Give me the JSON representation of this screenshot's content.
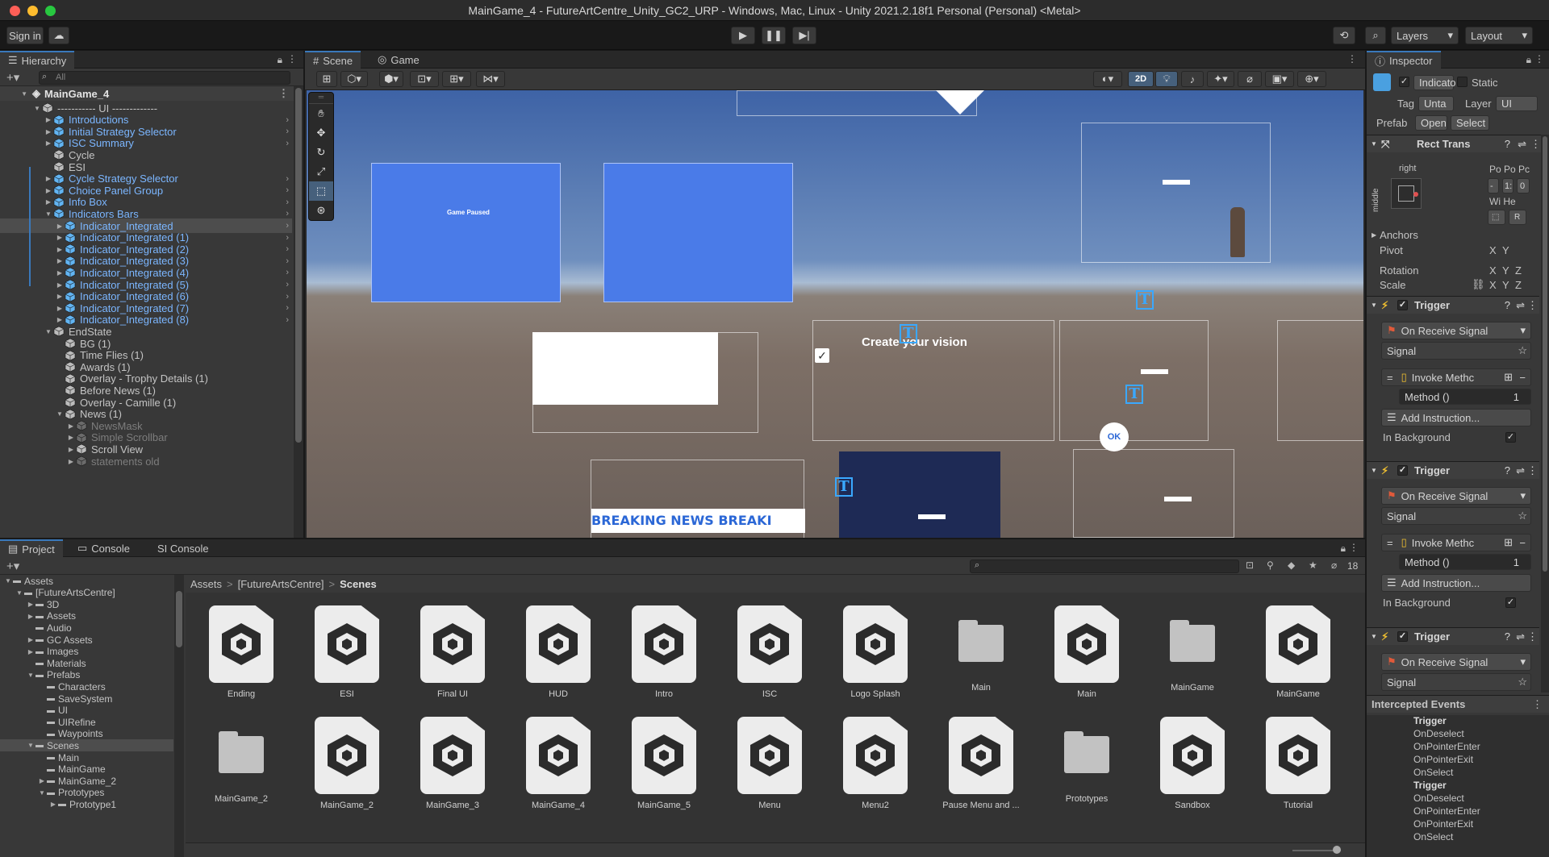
{
  "window": {
    "title": "MainGame_4 - FutureArtCentre_Unity_GC2_URP - Windows, Mac, Linux - Unity 2021.2.18f1 Personal (Personal) <Metal>"
  },
  "toolbar": {
    "sign_in": "Sign in",
    "layers": "Layers",
    "layout": "Layout"
  },
  "hierarchy": {
    "tab": "Hierarchy",
    "search_placeholder": "All",
    "scene_name": "MainGame_4",
    "rows": [
      {
        "label": "----------- UI -------------",
        "indent": 1,
        "style": "normal"
      },
      {
        "label": "Introductions",
        "indent": 2,
        "style": "blue"
      },
      {
        "label": "Initial Strategy Selector",
        "indent": 2,
        "style": "blue"
      },
      {
        "label": "ISC Summary",
        "indent": 2,
        "style": "blue"
      },
      {
        "label": "Cycle",
        "indent": 2,
        "style": "normal"
      },
      {
        "label": "ESI",
        "indent": 2,
        "style": "normal"
      },
      {
        "label": "Cycle Strategy Selector",
        "indent": 2,
        "style": "blue"
      },
      {
        "label": "Choice Panel Group",
        "indent": 2,
        "style": "blue"
      },
      {
        "label": "Info Box",
        "indent": 2,
        "style": "blue"
      },
      {
        "label": "Indicators Bars",
        "indent": 2,
        "style": "blue"
      },
      {
        "label": "Indicator_Integrated",
        "indent": 3,
        "style": "selected"
      },
      {
        "label": "Indicator_Integrated (1)",
        "indent": 3,
        "style": "blue"
      },
      {
        "label": "Indicator_Integrated (2)",
        "indent": 3,
        "style": "blue"
      },
      {
        "label": "Indicator_Integrated (3)",
        "indent": 3,
        "style": "blue"
      },
      {
        "label": "Indicator_Integrated (4)",
        "indent": 3,
        "style": "blue"
      },
      {
        "label": "Indicator_Integrated (5)",
        "indent": 3,
        "style": "blue"
      },
      {
        "label": "Indicator_Integrated (6)",
        "indent": 3,
        "style": "blue"
      },
      {
        "label": "Indicator_Integrated (7)",
        "indent": 3,
        "style": "blue"
      },
      {
        "label": "Indicator_Integrated (8)",
        "indent": 3,
        "style": "blue"
      },
      {
        "label": "EndState",
        "indent": 2,
        "style": "normal"
      },
      {
        "label": "BG (1)",
        "indent": 3,
        "style": "normal"
      },
      {
        "label": "Time Flies (1)",
        "indent": 3,
        "style": "normal"
      },
      {
        "label": "Awards (1)",
        "indent": 3,
        "style": "normal"
      },
      {
        "label": "Overlay - Trophy Details (1)",
        "indent": 3,
        "style": "normal"
      },
      {
        "label": "Before News (1)",
        "indent": 3,
        "style": "normal"
      },
      {
        "label": "Overlay - Camille (1)",
        "indent": 3,
        "style": "normal"
      },
      {
        "label": "News (1)",
        "indent": 3,
        "style": "normal"
      },
      {
        "label": "NewsMask",
        "indent": 4,
        "style": "dim"
      },
      {
        "label": "Simple Scrollbar",
        "indent": 4,
        "style": "dim"
      },
      {
        "label": "Scroll View",
        "indent": 4,
        "style": "normal"
      },
      {
        "label": "statements old",
        "indent": 4,
        "style": "dim"
      }
    ]
  },
  "scene_view": {
    "tab_scene": "Scene",
    "tab_game": "Game",
    "btn_2d": "2D",
    "overlay_text": {
      "game_paused": "Game Paused",
      "create_vision": "Create your vision",
      "breaking_news": "BREAKING NEWS   BREAKI",
      "ok": "OK"
    }
  },
  "project": {
    "tabs": [
      "Project",
      "Console",
      "SI Console"
    ],
    "hidden_count": "18",
    "breadcrumb": [
      "Assets",
      "[FutureArtsCentre]",
      "Scenes"
    ],
    "tree": [
      {
        "label": "Assets",
        "indent": 0
      },
      {
        "label": "[FutureArtsCentre]",
        "indent": 1
      },
      {
        "label": "3D",
        "indent": 2
      },
      {
        "label": "Assets",
        "indent": 2
      },
      {
        "label": "Audio",
        "indent": 2
      },
      {
        "label": "GC Assets",
        "indent": 2
      },
      {
        "label": "Images",
        "indent": 2
      },
      {
        "label": "Materials",
        "indent": 2
      },
      {
        "label": "Prefabs",
        "indent": 2
      },
      {
        "label": "Characters",
        "indent": 3
      },
      {
        "label": "SaveSystem",
        "indent": 3
      },
      {
        "label": "UI",
        "indent": 3
      },
      {
        "label": "UIRefine",
        "indent": 3
      },
      {
        "label": "Waypoints",
        "indent": 3
      },
      {
        "label": "Scenes",
        "indent": 2
      },
      {
        "label": "Main",
        "indent": 3
      },
      {
        "label": "MainGame",
        "indent": 3
      },
      {
        "label": "MainGame_2",
        "indent": 3
      },
      {
        "label": "Prototypes",
        "indent": 3
      },
      {
        "label": "Prototype1",
        "indent": 4
      }
    ],
    "items": [
      {
        "label": "Ending",
        "kind": "scene"
      },
      {
        "label": "ESI",
        "kind": "scene"
      },
      {
        "label": "Final UI",
        "kind": "scene"
      },
      {
        "label": "HUD",
        "kind": "scene"
      },
      {
        "label": "Intro",
        "kind": "scene"
      },
      {
        "label": "ISC",
        "kind": "scene"
      },
      {
        "label": "Logo Splash",
        "kind": "scene"
      },
      {
        "label": "Main",
        "kind": "folder"
      },
      {
        "label": "Main",
        "kind": "scene"
      },
      {
        "label": "MainGame",
        "kind": "folder"
      },
      {
        "label": "MainGame",
        "kind": "scene"
      },
      {
        "label": "MainGame_2",
        "kind": "folder"
      },
      {
        "label": "MainGame_2",
        "kind": "scene"
      },
      {
        "label": "MainGame_3",
        "kind": "scene"
      },
      {
        "label": "MainGame_4",
        "kind": "scene"
      },
      {
        "label": "MainGame_5",
        "kind": "scene"
      },
      {
        "label": "Menu",
        "kind": "scene"
      },
      {
        "label": "Menu2",
        "kind": "scene"
      },
      {
        "label": "Pause Menu and ...",
        "kind": "scene"
      },
      {
        "label": "Prototypes",
        "kind": "folder"
      },
      {
        "label": "Sandbox",
        "kind": "scene"
      },
      {
        "label": "Tutorial",
        "kind": "scene"
      }
    ]
  },
  "inspector": {
    "tab": "Inspector",
    "object_name": "Indicato",
    "static_label": "Static",
    "tag_label": "Tag",
    "tag_value": "Unta",
    "layer_label": "Layer",
    "layer_value": "UI",
    "prefab_label": "Prefab",
    "prefab_open": "Open",
    "prefab_select": "Select",
    "rect_transform": "Rect Trans",
    "anchor_h": "right",
    "anchor_v": "middle",
    "pos_headers": "Po Po Pc",
    "pos_values": [
      "-",
      "1:",
      "0"
    ],
    "size_headers": "Wi He",
    "anchors": "Anchors",
    "pivot": "Pivot",
    "rotation": "Rotation",
    "scale": "Scale",
    "axis_x": "X",
    "axis_y": "Y",
    "axis_z": "Z",
    "trigger_title": "Trigger",
    "on_receive_signal": "On Receive Signal",
    "signal": "Signal",
    "invoke_method": "Invoke Methc",
    "method": "Method ()",
    "method_count": "1",
    "add_instruction": "Add Instruction...",
    "in_background": "In Background",
    "intercepted_events": "Intercepted Events",
    "events": [
      "Trigger",
      "OnDeselect",
      "OnPointerEnter",
      "OnPointerExit",
      "OnSelect",
      "Trigger",
      "OnDeselect",
      "OnPointerEnter",
      "OnPointerExit",
      "OnSelect"
    ]
  },
  "colors": {
    "accent": "#3a79bb",
    "hierarchy_blue": "#7bb6ff",
    "scene_blue": "#4a7be8",
    "selection": "#4d4d4d"
  }
}
